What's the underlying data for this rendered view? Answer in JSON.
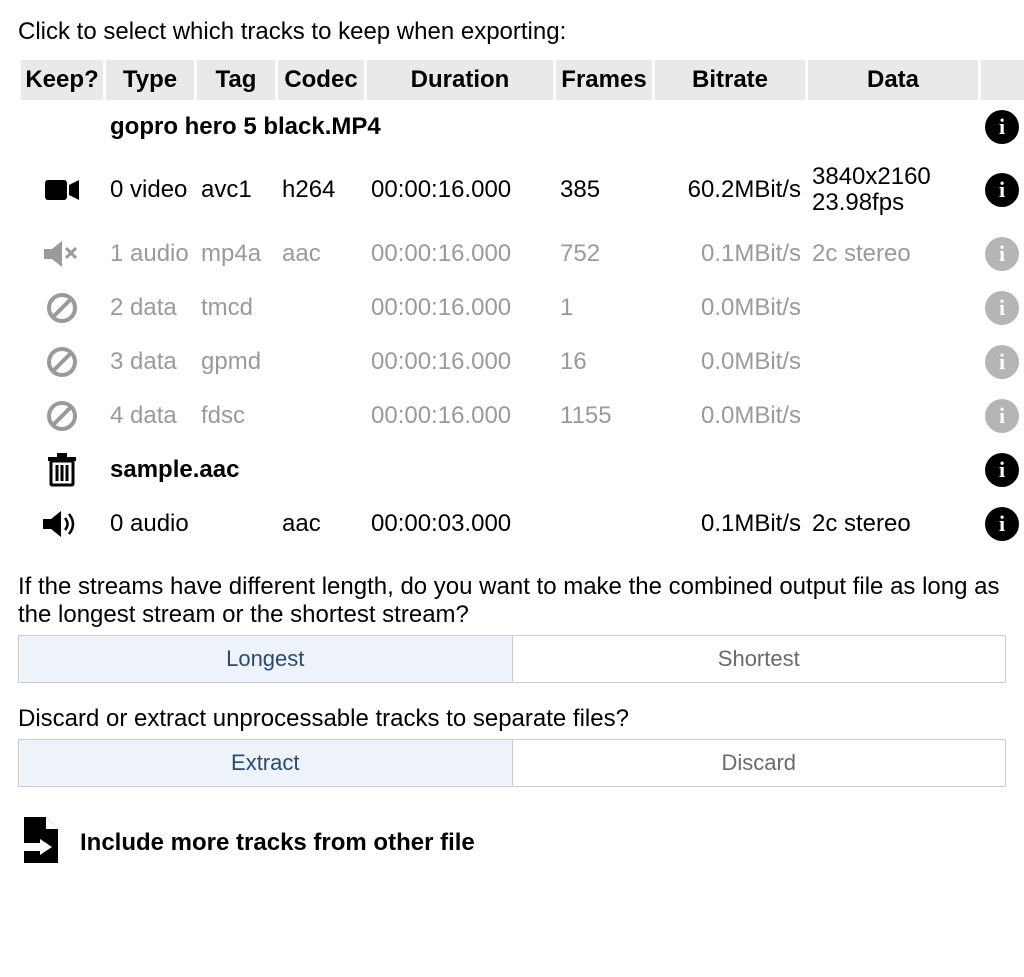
{
  "instruction": "Click to select which tracks to keep when exporting:",
  "headers": {
    "keep": "Keep?",
    "type": "Type",
    "tag": "Tag",
    "codec": "Codec",
    "duration": "Duration",
    "frames": "Frames",
    "bitrate": "Bitrate",
    "data": "Data"
  },
  "files": [
    {
      "name": "gopro hero 5 black.MP4",
      "name_icon": "none",
      "tracks": [
        {
          "id": "0",
          "kind": "video",
          "tag": "avc1",
          "codec": "h264",
          "duration": "00:00:16.000",
          "frames": "385",
          "bitrate": "60.2MBit/s",
          "data_l1": "3840x2160",
          "data_l2": "23.98fps",
          "state": "keep",
          "icon": "video",
          "info": "dark"
        },
        {
          "id": "1",
          "kind": "audio",
          "tag": "mp4a",
          "codec": "aac",
          "duration": "00:00:16.000",
          "frames": "752",
          "bitrate": "0.1MBit/s",
          "data_l1": "2c stereo",
          "data_l2": "",
          "state": "muted",
          "icon": "muted",
          "info": "grey"
        },
        {
          "id": "2",
          "kind": "data",
          "tag": "tmcd",
          "codec": "",
          "duration": "00:00:16.000",
          "frames": "1",
          "bitrate": "0.0MBit/s",
          "data_l1": "",
          "data_l2": "",
          "state": "discard",
          "icon": "ban",
          "info": "grey"
        },
        {
          "id": "3",
          "kind": "data",
          "tag": "gpmd",
          "codec": "",
          "duration": "00:00:16.000",
          "frames": "16",
          "bitrate": "0.0MBit/s",
          "data_l1": "",
          "data_l2": "",
          "state": "discard",
          "icon": "ban",
          "info": "grey"
        },
        {
          "id": "4",
          "kind": "data",
          "tag": "fdsc",
          "codec": "",
          "duration": "00:00:16.000",
          "frames": "1155",
          "bitrate": "0.0MBit/s",
          "data_l1": "",
          "data_l2": "",
          "state": "discard",
          "icon": "ban",
          "info": "grey"
        }
      ]
    },
    {
      "name": "sample.aac",
      "name_icon": "trash",
      "tracks": [
        {
          "id": "0",
          "kind": "audio",
          "tag": "",
          "codec": "aac",
          "duration": "00:00:03.000",
          "frames": "",
          "bitrate": "0.1MBit/s",
          "data_l1": "2c stereo",
          "data_l2": "",
          "state": "keep",
          "icon": "speaker",
          "info": "dark"
        }
      ]
    }
  ],
  "length_question": "If the streams have different length, do you want to make the combined output file as long as the longest stream or the shortest stream?",
  "length_options": {
    "longest": "Longest",
    "shortest": "Shortest",
    "selected": "longest"
  },
  "unproc_question": "Discard or extract unprocessable tracks to separate files?",
  "unproc_options": {
    "extract": "Extract",
    "discard": "Discard",
    "selected": "extract"
  },
  "include_label": "Include more tracks from other file",
  "info_glyph": "i"
}
